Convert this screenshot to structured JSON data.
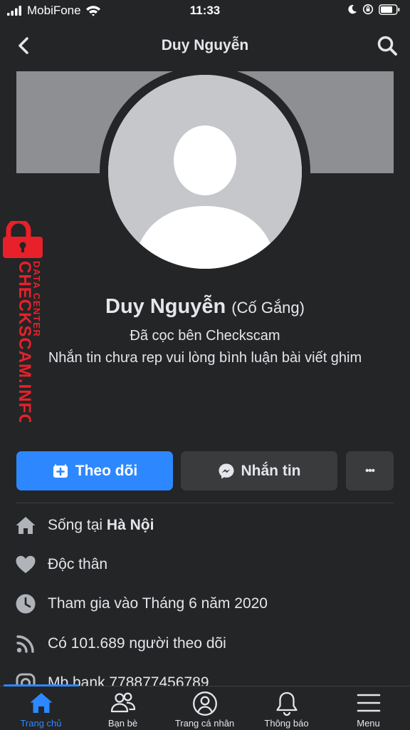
{
  "status_bar": {
    "carrier": "MobiFone",
    "time": "11:33"
  },
  "nav": {
    "title": "Duy Nguyễn"
  },
  "watermark": {
    "brand": "CHECKSCAM.INFO",
    "sub": "DATA CENTER"
  },
  "profile": {
    "name": "Duy Nguyễn",
    "alt_name": "(Cố Gắng)",
    "bio_line1": "Đã cọc bên Checkscam",
    "bio_line2": "Nhắn tin chưa rep vui lòng bình luận bài viết ghim"
  },
  "actions": {
    "follow_label": "Theo dõi",
    "message_label": "Nhắn tin",
    "more_label": "•••"
  },
  "details": {
    "lives_prefix": "Sống tại ",
    "lives_city": "Hà Nội",
    "relationship": "Độc thân",
    "joined": "Tham gia vào Tháng 6 năm 2020",
    "followers": "Có 101.689 người theo dõi",
    "bank": "Mb bank 778877456789"
  },
  "tabs": [
    {
      "label": "Trang chủ",
      "icon": "home-icon",
      "active": true
    },
    {
      "label": "Bạn bè",
      "icon": "friends-icon"
    },
    {
      "label": "Trang cá nhân",
      "icon": "profile-icon"
    },
    {
      "label": "Thông báo",
      "icon": "bell-icon"
    },
    {
      "label": "Menu",
      "icon": "menu-icon"
    }
  ],
  "colors": {
    "background": "#242526",
    "accent": "#2d88ff",
    "button_secondary": "#3a3b3c",
    "watermark_red": "#e8202a"
  }
}
